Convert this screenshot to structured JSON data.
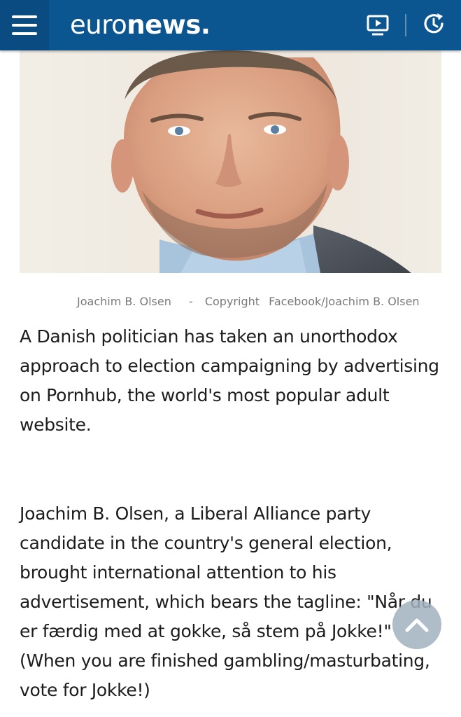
{
  "header": {
    "logo_light": "euro",
    "logo_bold": "news.",
    "menu_icon": "hamburger-menu-icon",
    "tv_icon": "live-tv-icon",
    "clock_icon": "latest-news-clock-icon",
    "brand_color": "#0b5591"
  },
  "image": {
    "alt": "Joachim B. Olsen"
  },
  "caption": {
    "name": "Joachim B. Olsen",
    "separator": "-",
    "copyright_label": "Copyright",
    "credit": "Facebook/Joachim B. Olsen"
  },
  "article": {
    "paragraph1": "A Danish politician has taken an unorthodox approach to election campaigning by advertising on Pornhub, the world's most popular adult website.",
    "paragraph2": "Joachim B. Olsen, a Liberal Alliance party candidate in the country's general election, brought international attention to his advertisement, which bears the tagline: \"Når du er færdig med at gokke, så stem på Jokke!\" (When you are finished gambling/masturbating, vote for Jokke!)"
  },
  "scroll_top": {
    "icon": "chevron-up-icon"
  }
}
